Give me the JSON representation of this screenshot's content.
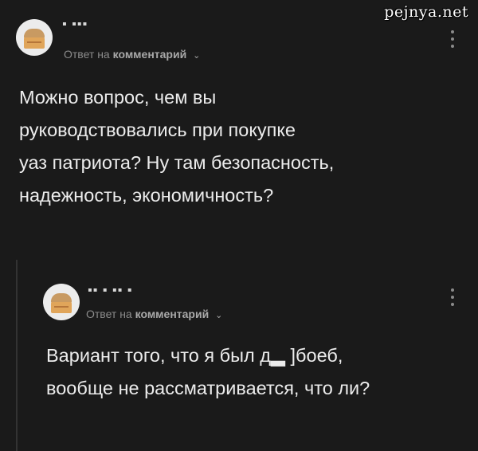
{
  "watermark": "pejnya.net",
  "comments": [
    {
      "username": "▪ ▪▪▪",
      "reply_prefix": "Ответ на",
      "reply_link": "комментарий",
      "text": "Можно вопрос, чем вы\nруководствовались при покупке\nуаз патриота? Ну там безопасность,\nнадежность, экономичность?"
    },
    {
      "username": "▪▪ ▪ ▪▪    ▪",
      "reply_prefix": "Ответ на",
      "reply_link": "комментарий",
      "text": "Вариант того, что я был д▂ ]боеб,\nвообще не рассматривается, что ли?"
    }
  ],
  "icons": {
    "avatar": "avatar-icon",
    "chevron": "chevron-down-icon",
    "menu": "more-vertical-icon"
  },
  "colors": {
    "background": "#1a1a1a",
    "text": "#ececec",
    "secondary": "#8b8b8b"
  }
}
